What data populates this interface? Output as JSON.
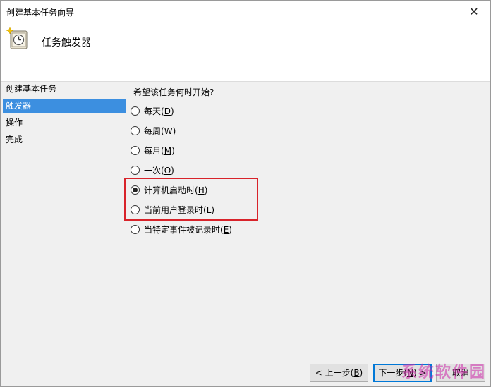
{
  "window": {
    "title": "创建基本任务向导",
    "close_glyph": "✕"
  },
  "header": {
    "heading": "任务触发器",
    "icon": "clock-icon"
  },
  "sidebar": {
    "items": [
      {
        "label": "创建基本任务",
        "active": false
      },
      {
        "label": "触发器",
        "active": true
      },
      {
        "label": "操作",
        "active": false
      },
      {
        "label": "完成",
        "active": false
      }
    ]
  },
  "content": {
    "question": "希望该任务何时开始?",
    "options": [
      {
        "label": "每天",
        "key": "D",
        "checked": false
      },
      {
        "label": "每周",
        "key": "W",
        "checked": false
      },
      {
        "label": "每月",
        "key": "M",
        "checked": false
      },
      {
        "label": "一次",
        "key": "O",
        "checked": false
      },
      {
        "label": "计算机启动时",
        "key": "H",
        "checked": true
      },
      {
        "label": "当前用户登录时",
        "key": "L",
        "checked": false
      },
      {
        "label": "当特定事件被记录时",
        "key": "E",
        "checked": false
      }
    ]
  },
  "footer": {
    "back": {
      "label": "< 上一步",
      "key": "B"
    },
    "next": {
      "label": "下一步",
      "key": "N"
    },
    "cancel": {
      "label": "取消"
    }
  },
  "watermark": "系统软件园",
  "colors": {
    "accent": "#0078d7",
    "selection": "#3c8fe0",
    "highlight": "#d8232a"
  }
}
